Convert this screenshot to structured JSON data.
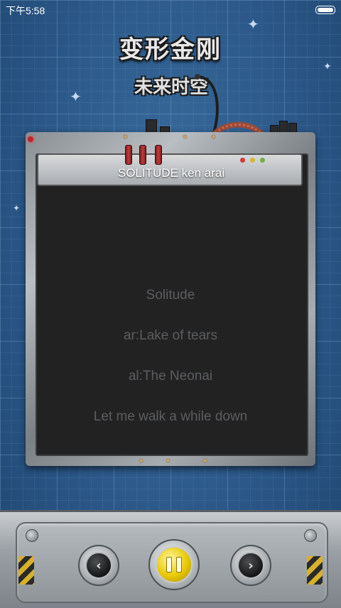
{
  "status_bar": {
    "time": "下午5:58"
  },
  "logo": {
    "line1": "变形金刚",
    "line2": "未来时空"
  },
  "player": {
    "title": "SOLITUDE   ken arai",
    "lyrics": [
      "Solitude",
      "ar:Lake of tears",
      "al:The Neonai",
      "Let me walk a while down"
    ]
  },
  "controls": {
    "prev_glyph": "‹",
    "next_glyph": "›"
  },
  "colors": {
    "accent": "#e8c900",
    "background": "#2d5f8e",
    "lyric": "#5b5d5f"
  }
}
